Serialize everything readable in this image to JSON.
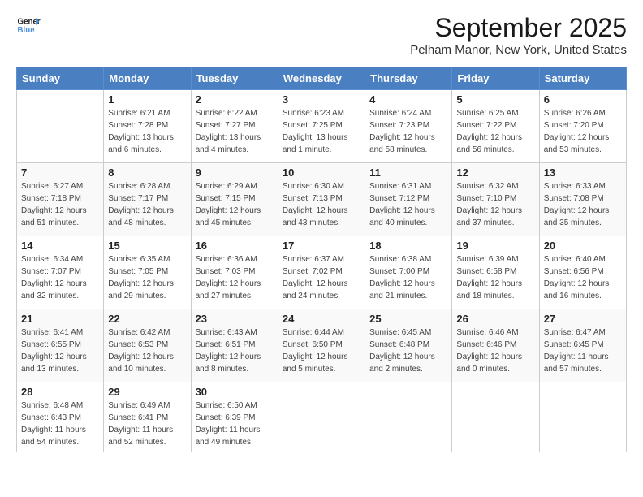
{
  "header": {
    "logo_line1": "General",
    "logo_line2": "Blue",
    "month": "September 2025",
    "location": "Pelham Manor, New York, United States"
  },
  "weekdays": [
    "Sunday",
    "Monday",
    "Tuesday",
    "Wednesday",
    "Thursday",
    "Friday",
    "Saturday"
  ],
  "weeks": [
    [
      {
        "day": "",
        "info": ""
      },
      {
        "day": "1",
        "info": "Sunrise: 6:21 AM\nSunset: 7:28 PM\nDaylight: 13 hours\nand 6 minutes."
      },
      {
        "day": "2",
        "info": "Sunrise: 6:22 AM\nSunset: 7:27 PM\nDaylight: 13 hours\nand 4 minutes."
      },
      {
        "day": "3",
        "info": "Sunrise: 6:23 AM\nSunset: 7:25 PM\nDaylight: 13 hours\nand 1 minute."
      },
      {
        "day": "4",
        "info": "Sunrise: 6:24 AM\nSunset: 7:23 PM\nDaylight: 12 hours\nand 58 minutes."
      },
      {
        "day": "5",
        "info": "Sunrise: 6:25 AM\nSunset: 7:22 PM\nDaylight: 12 hours\nand 56 minutes."
      },
      {
        "day": "6",
        "info": "Sunrise: 6:26 AM\nSunset: 7:20 PM\nDaylight: 12 hours\nand 53 minutes."
      }
    ],
    [
      {
        "day": "7",
        "info": "Sunrise: 6:27 AM\nSunset: 7:18 PM\nDaylight: 12 hours\nand 51 minutes."
      },
      {
        "day": "8",
        "info": "Sunrise: 6:28 AM\nSunset: 7:17 PM\nDaylight: 12 hours\nand 48 minutes."
      },
      {
        "day": "9",
        "info": "Sunrise: 6:29 AM\nSunset: 7:15 PM\nDaylight: 12 hours\nand 45 minutes."
      },
      {
        "day": "10",
        "info": "Sunrise: 6:30 AM\nSunset: 7:13 PM\nDaylight: 12 hours\nand 43 minutes."
      },
      {
        "day": "11",
        "info": "Sunrise: 6:31 AM\nSunset: 7:12 PM\nDaylight: 12 hours\nand 40 minutes."
      },
      {
        "day": "12",
        "info": "Sunrise: 6:32 AM\nSunset: 7:10 PM\nDaylight: 12 hours\nand 37 minutes."
      },
      {
        "day": "13",
        "info": "Sunrise: 6:33 AM\nSunset: 7:08 PM\nDaylight: 12 hours\nand 35 minutes."
      }
    ],
    [
      {
        "day": "14",
        "info": "Sunrise: 6:34 AM\nSunset: 7:07 PM\nDaylight: 12 hours\nand 32 minutes."
      },
      {
        "day": "15",
        "info": "Sunrise: 6:35 AM\nSunset: 7:05 PM\nDaylight: 12 hours\nand 29 minutes."
      },
      {
        "day": "16",
        "info": "Sunrise: 6:36 AM\nSunset: 7:03 PM\nDaylight: 12 hours\nand 27 minutes."
      },
      {
        "day": "17",
        "info": "Sunrise: 6:37 AM\nSunset: 7:02 PM\nDaylight: 12 hours\nand 24 minutes."
      },
      {
        "day": "18",
        "info": "Sunrise: 6:38 AM\nSunset: 7:00 PM\nDaylight: 12 hours\nand 21 minutes."
      },
      {
        "day": "19",
        "info": "Sunrise: 6:39 AM\nSunset: 6:58 PM\nDaylight: 12 hours\nand 18 minutes."
      },
      {
        "day": "20",
        "info": "Sunrise: 6:40 AM\nSunset: 6:56 PM\nDaylight: 12 hours\nand 16 minutes."
      }
    ],
    [
      {
        "day": "21",
        "info": "Sunrise: 6:41 AM\nSunset: 6:55 PM\nDaylight: 12 hours\nand 13 minutes."
      },
      {
        "day": "22",
        "info": "Sunrise: 6:42 AM\nSunset: 6:53 PM\nDaylight: 12 hours\nand 10 minutes."
      },
      {
        "day": "23",
        "info": "Sunrise: 6:43 AM\nSunset: 6:51 PM\nDaylight: 12 hours\nand 8 minutes."
      },
      {
        "day": "24",
        "info": "Sunrise: 6:44 AM\nSunset: 6:50 PM\nDaylight: 12 hours\nand 5 minutes."
      },
      {
        "day": "25",
        "info": "Sunrise: 6:45 AM\nSunset: 6:48 PM\nDaylight: 12 hours\nand 2 minutes."
      },
      {
        "day": "26",
        "info": "Sunrise: 6:46 AM\nSunset: 6:46 PM\nDaylight: 12 hours\nand 0 minutes."
      },
      {
        "day": "27",
        "info": "Sunrise: 6:47 AM\nSunset: 6:45 PM\nDaylight: 11 hours\nand 57 minutes."
      }
    ],
    [
      {
        "day": "28",
        "info": "Sunrise: 6:48 AM\nSunset: 6:43 PM\nDaylight: 11 hours\nand 54 minutes."
      },
      {
        "day": "29",
        "info": "Sunrise: 6:49 AM\nSunset: 6:41 PM\nDaylight: 11 hours\nand 52 minutes."
      },
      {
        "day": "30",
        "info": "Sunrise: 6:50 AM\nSunset: 6:39 PM\nDaylight: 11 hours\nand 49 minutes."
      },
      {
        "day": "",
        "info": ""
      },
      {
        "day": "",
        "info": ""
      },
      {
        "day": "",
        "info": ""
      },
      {
        "day": "",
        "info": ""
      }
    ]
  ]
}
